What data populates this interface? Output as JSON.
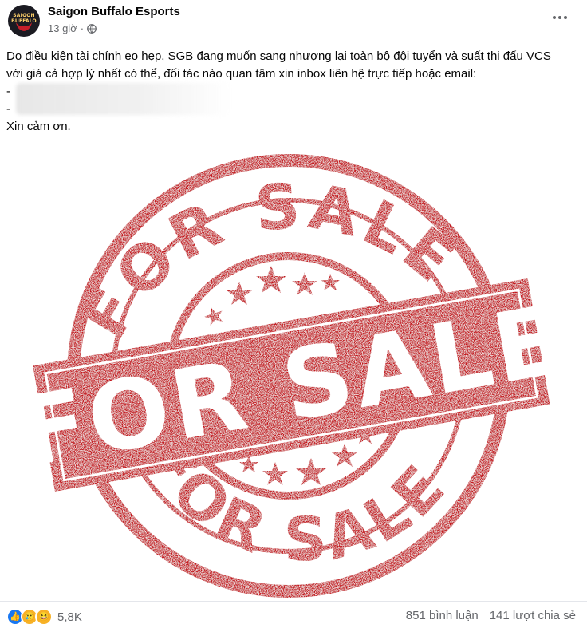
{
  "header": {
    "page_name": "Saigon Buffalo Esports",
    "time": "13 giờ",
    "avatar_text": "SAIGON BUFFALO",
    "audience_icon": "globe-icon"
  },
  "post": {
    "line1": "Do điều kiện tài chính eo hẹp, SGB đang muốn sang nhượng lại toàn bộ đội tuyển và suất thi đấu VCS với giá cả hợp lý nhất có thể, đối tác nào quan tâm xin inbox liên hệ trực tiếp hoặc email:",
    "bullet1": "- ",
    "bullet2": "- ",
    "closing": "Xin cảm ơn."
  },
  "image": {
    "banner_text": "FOR SALE",
    "top_arc": "FOR SALE",
    "bottom_arc": "FOR SALE",
    "color": "#c4161c"
  },
  "footer": {
    "reaction_icons": [
      "like-icon",
      "sad-icon",
      "haha-icon"
    ],
    "reaction_count": "5,8K",
    "comments": "851 bình luận",
    "shares": "141 lượt chia sẻ"
  }
}
